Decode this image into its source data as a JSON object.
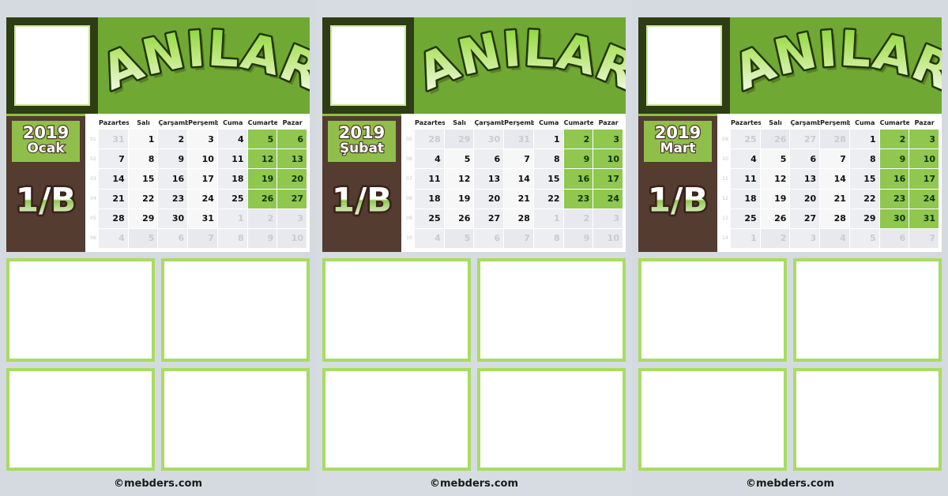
{
  "page": {
    "background_color": "#d4dae0",
    "accent_green": "#6fa832",
    "light_green": "#8fbf4a",
    "frame_green": "#a8dc62",
    "brown": "#553c31",
    "dark_green": "#2e3d13",
    "footer_text": "©mebders.com"
  },
  "weekdays": [
    "Pazartesi",
    "Salı",
    "Çarşamba",
    "Perşembe",
    "Cuma",
    "Cumartesi",
    "Pazar"
  ],
  "panels": [
    {
      "title": "ANILAR",
      "year": "2019",
      "month": "Ocak",
      "class_label": "1/B",
      "footer": "©mebders.com",
      "week_numbers": [
        "01",
        "02",
        "03",
        "04",
        "05",
        "06"
      ],
      "weeks": [
        [
          {
            "d": "31",
            "o": true
          },
          {
            "d": "1"
          },
          {
            "d": "2"
          },
          {
            "d": "3"
          },
          {
            "d": "4"
          },
          {
            "d": "5",
            "we": true
          },
          {
            "d": "6",
            "we": true
          }
        ],
        [
          {
            "d": "7"
          },
          {
            "d": "8"
          },
          {
            "d": "9"
          },
          {
            "d": "10"
          },
          {
            "d": "11"
          },
          {
            "d": "12",
            "we": true
          },
          {
            "d": "13",
            "we": true
          }
        ],
        [
          {
            "d": "14"
          },
          {
            "d": "15"
          },
          {
            "d": "16"
          },
          {
            "d": "17"
          },
          {
            "d": "18"
          },
          {
            "d": "19",
            "we": true
          },
          {
            "d": "20",
            "we": true
          }
        ],
        [
          {
            "d": "21"
          },
          {
            "d": "22"
          },
          {
            "d": "23"
          },
          {
            "d": "24"
          },
          {
            "d": "25"
          },
          {
            "d": "26",
            "we": true
          },
          {
            "d": "27",
            "we": true
          }
        ],
        [
          {
            "d": "28"
          },
          {
            "d": "29"
          },
          {
            "d": "30"
          },
          {
            "d": "31"
          },
          {
            "d": "1",
            "o": true
          },
          {
            "d": "2",
            "we": true,
            "o": true
          },
          {
            "d": "3",
            "we": true,
            "o": true
          }
        ],
        [
          {
            "d": "4",
            "o": true
          },
          {
            "d": "5",
            "o": true
          },
          {
            "d": "6",
            "o": true
          },
          {
            "d": "7",
            "o": true
          },
          {
            "d": "8",
            "o": true
          },
          {
            "d": "9",
            "we": true,
            "o": true
          },
          {
            "d": "10",
            "we": true,
            "o": true
          }
        ]
      ]
    },
    {
      "title": "ANILAR",
      "year": "2019",
      "month": "Şubat",
      "class_label": "1/B",
      "footer": "©mebders.com",
      "week_numbers": [
        "05",
        "06",
        "07",
        "08",
        "09",
        "10"
      ],
      "weeks": [
        [
          {
            "d": "28",
            "o": true
          },
          {
            "d": "29",
            "o": true
          },
          {
            "d": "30",
            "o": true
          },
          {
            "d": "31",
            "o": true
          },
          {
            "d": "1"
          },
          {
            "d": "2",
            "we": true
          },
          {
            "d": "3",
            "we": true
          }
        ],
        [
          {
            "d": "4"
          },
          {
            "d": "5"
          },
          {
            "d": "6"
          },
          {
            "d": "7"
          },
          {
            "d": "8"
          },
          {
            "d": "9",
            "we": true
          },
          {
            "d": "10",
            "we": true
          }
        ],
        [
          {
            "d": "11"
          },
          {
            "d": "12"
          },
          {
            "d": "13"
          },
          {
            "d": "14"
          },
          {
            "d": "15"
          },
          {
            "d": "16",
            "we": true
          },
          {
            "d": "17",
            "we": true
          }
        ],
        [
          {
            "d": "18"
          },
          {
            "d": "19"
          },
          {
            "d": "20"
          },
          {
            "d": "21"
          },
          {
            "d": "22"
          },
          {
            "d": "23",
            "we": true
          },
          {
            "d": "24",
            "we": true
          }
        ],
        [
          {
            "d": "25"
          },
          {
            "d": "26"
          },
          {
            "d": "27"
          },
          {
            "d": "28"
          },
          {
            "d": "1",
            "o": true
          },
          {
            "d": "2",
            "we": true,
            "o": true
          },
          {
            "d": "3",
            "we": true,
            "o": true
          }
        ],
        [
          {
            "d": "4",
            "o": true
          },
          {
            "d": "5",
            "o": true
          },
          {
            "d": "6",
            "o": true
          },
          {
            "d": "7",
            "o": true
          },
          {
            "d": "8",
            "o": true
          },
          {
            "d": "9",
            "we": true,
            "o": true
          },
          {
            "d": "10",
            "we": true,
            "o": true
          }
        ]
      ]
    },
    {
      "title": "ANILAR",
      "year": "2019",
      "month": "Mart",
      "class_label": "1/B",
      "footer": "©mebders.com",
      "week_numbers": [
        "09",
        "10",
        "11",
        "12",
        "13",
        "14"
      ],
      "weeks": [
        [
          {
            "d": "25",
            "o": true
          },
          {
            "d": "26",
            "o": true
          },
          {
            "d": "27",
            "o": true
          },
          {
            "d": "28",
            "o": true
          },
          {
            "d": "1"
          },
          {
            "d": "2",
            "we": true
          },
          {
            "d": "3",
            "we": true
          }
        ],
        [
          {
            "d": "4"
          },
          {
            "d": "5"
          },
          {
            "d": "6"
          },
          {
            "d": "7"
          },
          {
            "d": "8"
          },
          {
            "d": "9",
            "we": true
          },
          {
            "d": "10",
            "we": true
          }
        ],
        [
          {
            "d": "11"
          },
          {
            "d": "12"
          },
          {
            "d": "13"
          },
          {
            "d": "14"
          },
          {
            "d": "15"
          },
          {
            "d": "16",
            "we": true
          },
          {
            "d": "17",
            "we": true
          }
        ],
        [
          {
            "d": "18"
          },
          {
            "d": "19"
          },
          {
            "d": "20"
          },
          {
            "d": "21"
          },
          {
            "d": "22"
          },
          {
            "d": "23",
            "we": true
          },
          {
            "d": "24",
            "we": true
          }
        ],
        [
          {
            "d": "25"
          },
          {
            "d": "26"
          },
          {
            "d": "27"
          },
          {
            "d": "28"
          },
          {
            "d": "29"
          },
          {
            "d": "30",
            "we": true
          },
          {
            "d": "31",
            "we": true
          }
        ],
        [
          {
            "d": "1",
            "o": true
          },
          {
            "d": "2",
            "o": true
          },
          {
            "d": "3",
            "o": true
          },
          {
            "d": "4",
            "o": true
          },
          {
            "d": "5",
            "o": true
          },
          {
            "d": "6",
            "we": true,
            "o": true
          },
          {
            "d": "7",
            "we": true,
            "o": true
          }
        ]
      ]
    }
  ],
  "photo_slots_per_panel": 4,
  "photo_frame_portrait_name": "portrait-photo-placeholder"
}
